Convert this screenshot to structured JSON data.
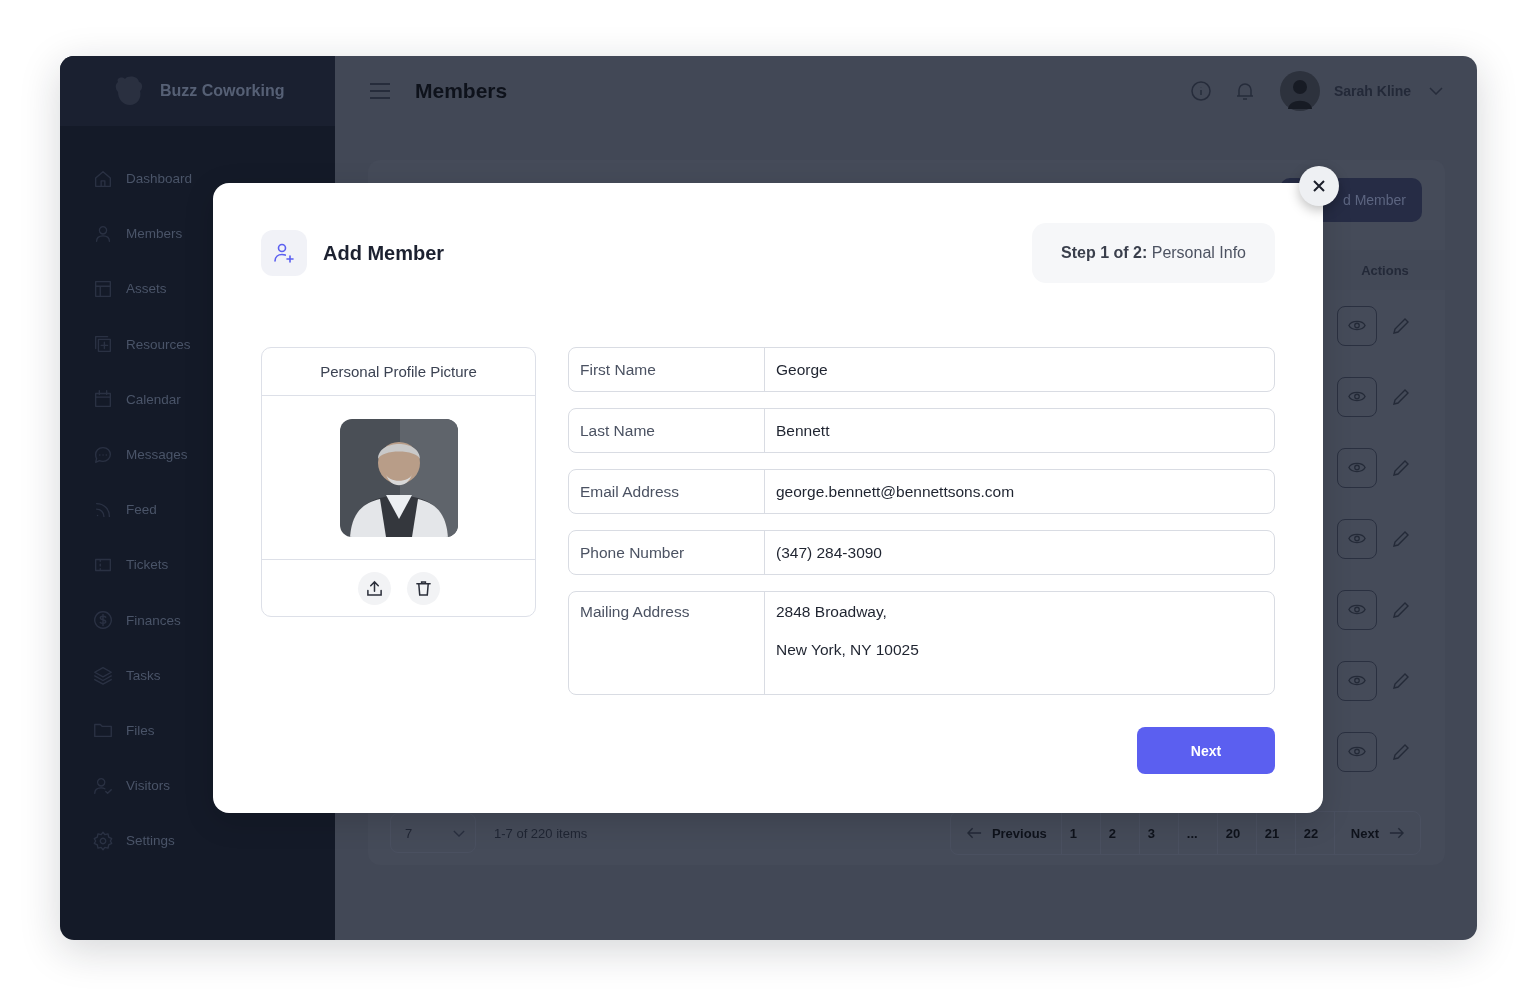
{
  "app": {
    "name": "Buzz Coworking"
  },
  "sidebar": {
    "items": [
      {
        "label": "Dashboard"
      },
      {
        "label": "Members"
      },
      {
        "label": "Assets"
      },
      {
        "label": "Resources"
      },
      {
        "label": "Calendar"
      },
      {
        "label": "Messages"
      },
      {
        "label": "Feed"
      },
      {
        "label": "Tickets"
      },
      {
        "label": "Finances"
      },
      {
        "label": "Tasks"
      },
      {
        "label": "Files"
      },
      {
        "label": "Visitors"
      },
      {
        "label": "Settings"
      }
    ]
  },
  "header": {
    "title": "Members",
    "user": {
      "name": "Sarah Kline"
    }
  },
  "page": {
    "add_button": "d Member",
    "table": {
      "columns": [
        "Actions"
      ]
    },
    "pagination": {
      "page_size": "7",
      "summary": "1-7 of 220 items",
      "previous": "Previous",
      "pages": [
        "1",
        "2",
        "3",
        "...",
        "20",
        "21",
        "22"
      ],
      "next": "Next"
    }
  },
  "modal": {
    "title": "Add Member",
    "step": "**Step 1 of 2:** Personal Info",
    "profile_picture": {
      "title": "Personal Profile Picture"
    },
    "fields": [
      {
        "kind": "line",
        "label": "First Name",
        "value": "George"
      },
      {
        "kind": "line",
        "label": "Last Name",
        "value": "Bennett"
      },
      {
        "kind": "line",
        "label": "Email Address",
        "value": "george.bennett@bennettsons.com"
      },
      {
        "kind": "line",
        "label": "Phone Number",
        "value": "(347) 284-3090"
      },
      {
        "kind": "multiline",
        "label": "Mailing Address",
        "lines": [
          "2848 Broadway,",
          "New York, NY 10025"
        ]
      }
    ],
    "next_button": "Next"
  }
}
